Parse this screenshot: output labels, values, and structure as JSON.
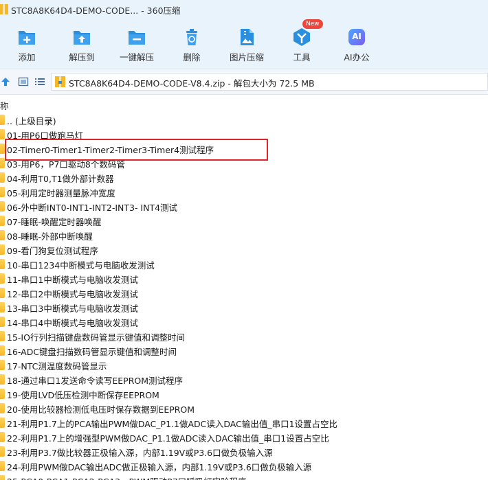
{
  "window": {
    "title": "STC8A8K64D4-DEMO-CODE... - 360压缩"
  },
  "toolbar": {
    "items": [
      {
        "label": "添加",
        "icon": "add-icon"
      },
      {
        "label": "解压到",
        "icon": "extract-to-icon"
      },
      {
        "label": "一键解压",
        "icon": "one-click-extract-icon"
      },
      {
        "label": "删除",
        "icon": "delete-icon"
      },
      {
        "label": "图片压缩",
        "icon": "image-compress-icon"
      },
      {
        "label": "工具",
        "icon": "tools-icon",
        "badge": "New"
      },
      {
        "label": "AI办公",
        "icon": "ai-office-icon"
      }
    ],
    "colors": {
      "accent": "#2b8fe0",
      "badge": "#f0453a"
    }
  },
  "address": {
    "path": "STC8A8K64D4-DEMO-CODE-V8.4.zip - 解包大小为 72.5 MB"
  },
  "columns": {
    "name": "称"
  },
  "files": [
    ".. (上级目录)",
    "01-用P6口做跑马灯",
    "02-Timer0-Timer1-Timer2-Timer3-Timer4测试程序",
    "03-用P6，P7口驱动8个数码管",
    "04-利用T0,T1做外部计数器",
    "05-利用定时器测量脉冲宽度",
    "06-外中断INT0-INT1-INT2-INT3- INT4测试",
    "07-睡眠-唤醒定时器唤醒",
    "08-睡眠-外部中断唤醒",
    "09-看门狗复位测试程序",
    "10-串口1234中断模式与电脑收发测试",
    "11-串口1中断模式与电脑收发测试",
    "12-串口2中断模式与电脑收发测试",
    "13-串口3中断模式与电脑收发测试",
    "14-串口4中断模式与电脑收发测试",
    "15-IO行列扫描键盘数码管显示键值和调整时间",
    "16-ADC键盘扫描数码管显示键值和调整时间",
    "17-NTC测温度数码管显示",
    "18-通过串口1发送命令读写EEPROM测试程序",
    "19-使用LVD低压检测中断保存EEPROM",
    "20-使用比较器检测低电压时保存数据到EEPROM",
    "21-利用P1.7上的PCA输出PWM做DAC_P1.1做ADC读入DAC输出值_串口1设置占空比",
    "22-利用P1.7上的增强型PWM做DAC_P1.1做ADC读入DAC输出值_串口1设置占空比",
    "23-利用P3.7做比较器正极输入源，内部1.19V或P3.6口做负极输入源",
    "24-利用PWM做DAC输出ADC做正极输入源，内部1.19V或P3.6口做负极输入源",
    "25-PCA0-PCA1-PCA2-PCA3 - PWM驱动P7口呼吸灯实验程序"
  ],
  "selection_highlight_color": "#e0242a"
}
